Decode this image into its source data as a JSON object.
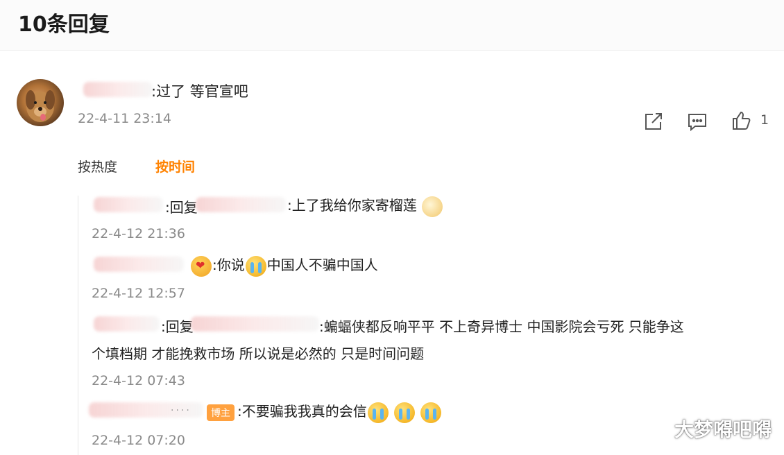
{
  "header": {
    "title": "10条回复"
  },
  "main_comment": {
    "text": ":过了 等官宣吧",
    "time": "22-4-11 23:14",
    "like_count": "1",
    "icons": {
      "share": "share-icon",
      "comment": "comment-icon",
      "like": "like-icon"
    }
  },
  "sort": {
    "hot_label": "按热度",
    "time_label": "按时间",
    "active": "time",
    "accent_color": "#ff8200"
  },
  "replies": [
    {
      "prefix": ":回复",
      "text": ":上了我给你家寄榴莲",
      "time": "22-4-12 21:36"
    },
    {
      "text": ":你说",
      "text2": "中国人不骗中国人",
      "time": "22-4-12 12:57"
    },
    {
      "prefix": ":回复",
      "text_line1": ":蝙蝠侠都反响平平 不上奇异博士 中国影院会亏死 只能争这",
      "text_line2": "个填档期 才能挽救市场 所以说是必然的 只是时间问题",
      "time": "22-4-12 07:43"
    },
    {
      "badge": "博主",
      "text": ":不要骗我我真的会信",
      "time": "22-4-12 07:20"
    }
  ],
  "watermark": "大梦嘚吧嘚"
}
